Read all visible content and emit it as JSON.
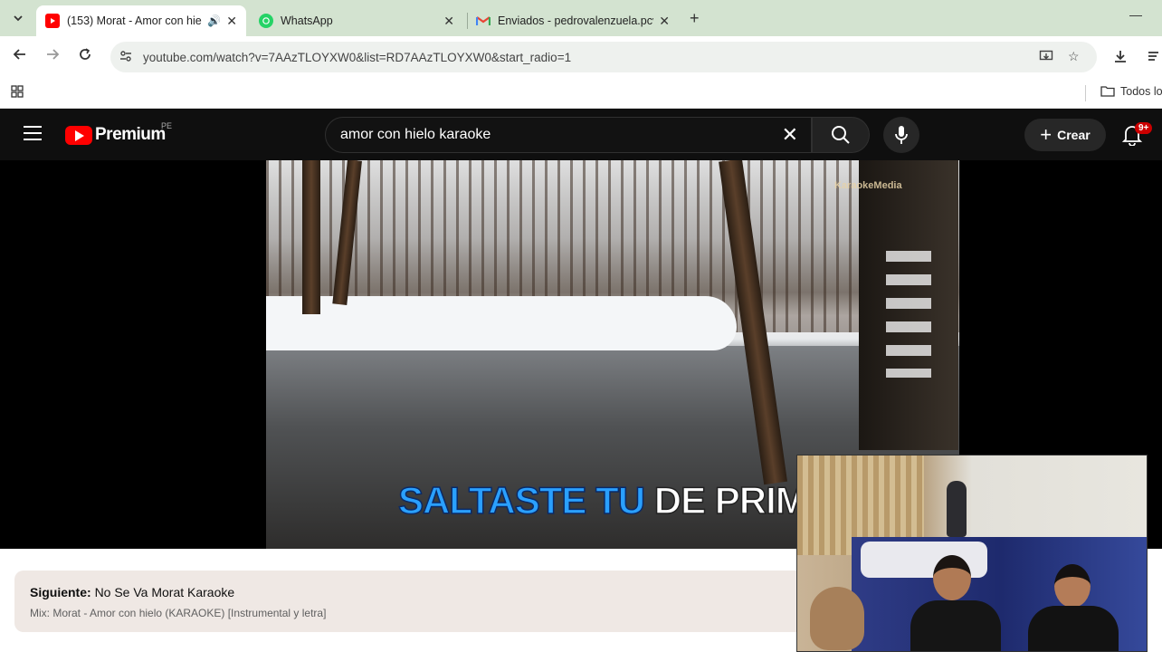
{
  "browser": {
    "tabs": [
      {
        "title": "(153) Morat - Amor con hie",
        "active": true,
        "favicon": "youtube-icon",
        "audio": true
      },
      {
        "title": "WhatsApp",
        "active": false,
        "favicon": "whatsapp-icon"
      },
      {
        "title": "Enviados - pedrovalenzuela.pcv",
        "active": false,
        "favicon": "gmail-icon"
      }
    ],
    "url": "youtube.com/watch?v=7AAzTLOYXW0&list=RD7AAzTLOYXW0&start_radio=1",
    "bookmarks_folder": "Todos lo"
  },
  "youtube": {
    "brand": "Premium",
    "region": "PE",
    "search_query": "amor con hielo karaoke",
    "create_label": "Crear",
    "notification_badge": "9+",
    "accent_color": "#ff0000"
  },
  "video": {
    "watermark": "KaraokeMedia",
    "lyric_sung": "SALTASTE TU",
    "lyric_unsung": " DE PRIMER"
  },
  "up_next": {
    "label": "Siguiente:",
    "title": "No Se Va Morat Karaoke",
    "mix": "Mix: Morat - Amor con hielo (KARAOKE) [Instrumental y letra]"
  }
}
